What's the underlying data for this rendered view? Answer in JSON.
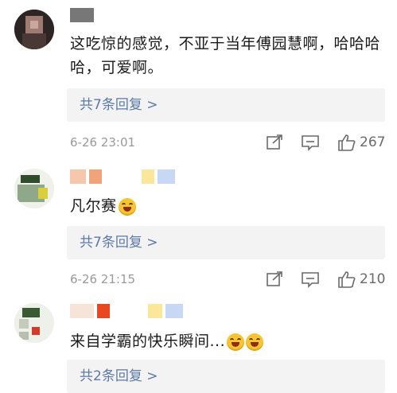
{
  "comments": [
    {
      "text": "这吃惊的感觉，不亚于当年傅园慧啊，哈哈哈哈，可爱啊。",
      "replies_label": "共7条回复 >",
      "time": "6-26 23:01",
      "likes": "267"
    },
    {
      "text": "凡尔赛",
      "replies_label": "共7条回复 >",
      "time": "6-26 21:15",
      "likes": "210"
    },
    {
      "text": "来自学霸的快乐瞬间...",
      "replies_label": "共2条回复 >"
    }
  ],
  "icons": {
    "share": "share-icon",
    "comment": "comment-icon",
    "like": "thumbs-up-icon",
    "emoji": "laughing-emoji-icon"
  },
  "colors": {
    "reply_link": "#5b7aa6",
    "meta_gray": "#9a9a9a",
    "reply_bg": "#f3f3f3"
  }
}
